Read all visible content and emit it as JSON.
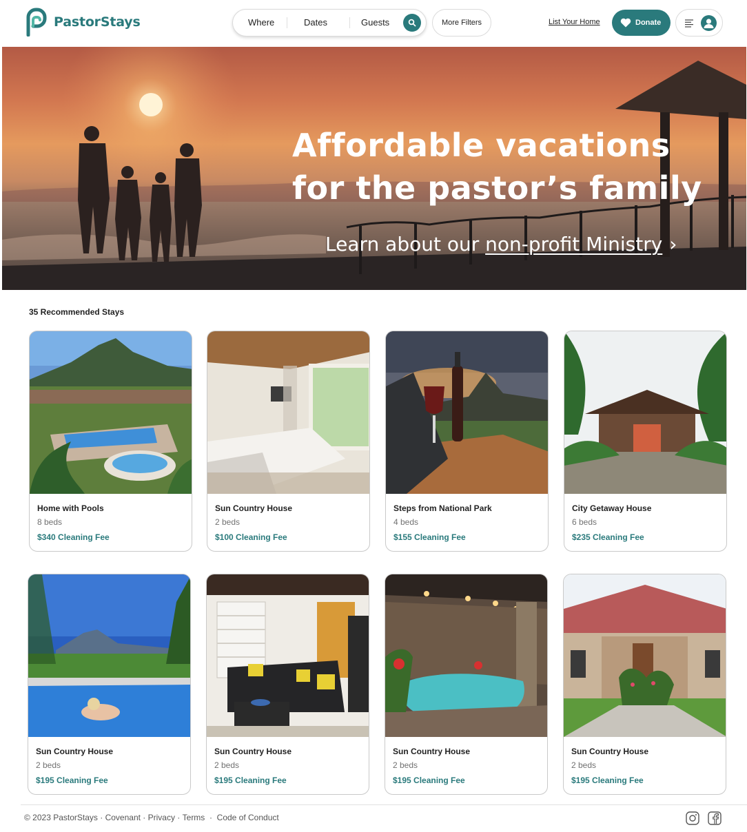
{
  "header": {
    "brand": "PastorStays",
    "search": {
      "where": "Where",
      "dates": "Dates",
      "guests": "Guests"
    },
    "more_filters": "More Filters",
    "list_home": "List Your Home",
    "donate": "Donate"
  },
  "hero": {
    "title_line1": "Affordable vacations",
    "title_line2": "for the pastor’s family",
    "link_prefix": "Learn about our ",
    "link_underlined": "non-profit Ministry",
    "link_chevron": "›"
  },
  "listings": {
    "heading": "35 Recommended Stays",
    "items": [
      {
        "title": "Home with Pools",
        "beds": "8 beds",
        "fee": "$340 Cleaning Fee"
      },
      {
        "title": "Sun Country House",
        "beds": "2 beds",
        "fee": "$100 Cleaning Fee"
      },
      {
        "title": "Steps from National Park",
        "beds": "4 beds",
        "fee": "$155 Cleaning Fee"
      },
      {
        "title": "City Getaway House",
        "beds": "6 beds",
        "fee": "$235 Cleaning Fee"
      },
      {
        "title": "Sun Country House",
        "beds": "2 beds",
        "fee": "$195 Cleaning Fee"
      },
      {
        "title": "Sun Country House",
        "beds": "2 beds",
        "fee": "$195 Cleaning Fee"
      },
      {
        "title": "Sun Country House",
        "beds": "2 beds",
        "fee": "$195 Cleaning Fee"
      },
      {
        "title": "Sun Country House",
        "beds": "2 beds",
        "fee": "$195 Cleaning Fee"
      }
    ]
  },
  "footer": {
    "copyright": "© 2023 PastorStays",
    "sep": " · ",
    "covenant": "Covenant",
    "privacy": "Privacy",
    "terms": "Terms",
    "conduct": "Code of Conduct",
    "sep2": "  ·  "
  },
  "icons": {
    "logo": "pastorstays-logo-icon",
    "search": "search-icon",
    "heart": "heart-icon",
    "menu": "menu-lines-icon",
    "user": "user-avatar-icon",
    "instagram": "instagram-icon",
    "facebook": "facebook-icon"
  },
  "colors": {
    "brand": "#2a7a7c",
    "text": "#222222",
    "muted": "#717171"
  }
}
